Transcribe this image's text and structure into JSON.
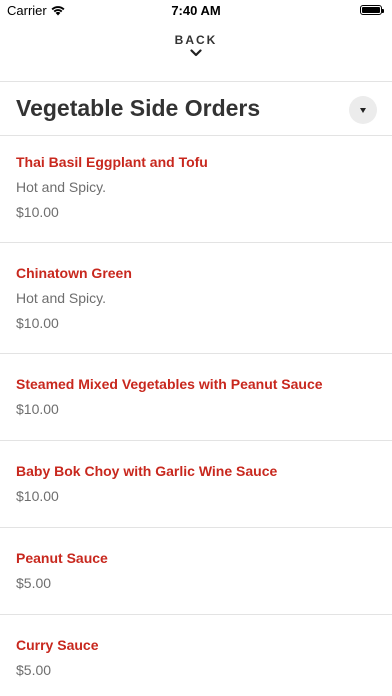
{
  "status_bar": {
    "carrier": "Carrier",
    "time": "7:40 AM"
  },
  "nav": {
    "back_label": "BACK"
  },
  "section": {
    "title": "Vegetable Side Orders"
  },
  "items": [
    {
      "name": "Thai Basil Eggplant and Tofu",
      "description": "Hot and Spicy.",
      "price": "$10.00"
    },
    {
      "name": "Chinatown Green",
      "description": "Hot and Spicy.",
      "price": "$10.00"
    },
    {
      "name": "Steamed Mixed Vegetables with Peanut Sauce",
      "price": "$10.00"
    },
    {
      "name": "Baby Bok Choy with Garlic Wine Sauce",
      "price": "$10.00"
    },
    {
      "name": "Peanut Sauce",
      "price": "$5.00"
    },
    {
      "name": "Curry Sauce",
      "price": "$5.00"
    }
  ],
  "colors": {
    "item_name": "#c8281e",
    "secondary_text": "#6e6e6e",
    "divider": "#e3e3e3"
  },
  "icons": {
    "wifi": "wifi-icon",
    "battery": "battery-icon",
    "back": "chevron-down-icon",
    "dropdown": "caret-down-icon"
  }
}
